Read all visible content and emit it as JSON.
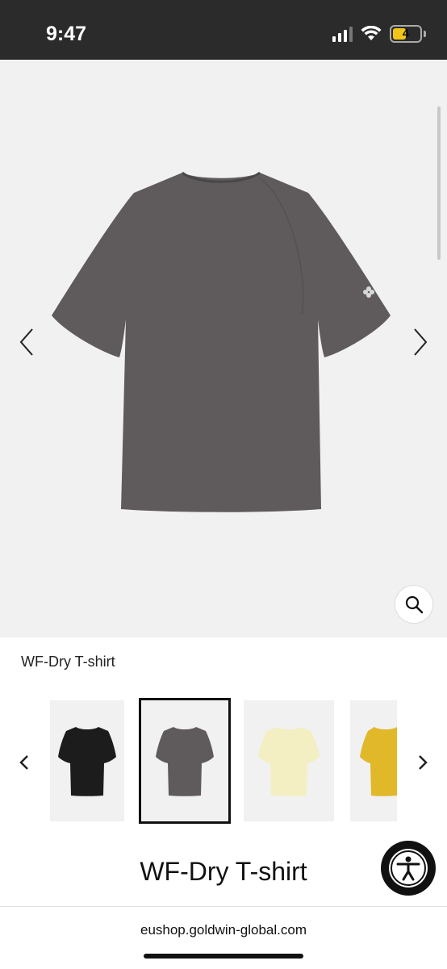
{
  "status": {
    "time": "9:47",
    "battery": "4",
    "icons": [
      "signal-icon",
      "wifi-icon",
      "battery-icon"
    ]
  },
  "gallery": {
    "prev_icon": "chevron-left-icon",
    "next_icon": "chevron-right-icon",
    "zoom_icon": "search-icon",
    "shirt_color": "#5f5b5c"
  },
  "product": {
    "name_small": "WF-Dry T-shirt",
    "title": "WF-Dry T-shirt"
  },
  "swatches": {
    "prev_icon": "chevron-left-icon",
    "next_icon": "chevron-right-icon",
    "items": [
      {
        "color": "#1c1c1c",
        "selected": false
      },
      {
        "color": "#5f5b5c",
        "selected": true
      },
      {
        "color": "#f3efc3",
        "selected": false
      },
      {
        "color": "#e0b82a",
        "selected": false
      }
    ]
  },
  "accessibility": {
    "icon": "accessibility-icon"
  },
  "browser": {
    "url": "eushop.goldwin-global.com"
  }
}
